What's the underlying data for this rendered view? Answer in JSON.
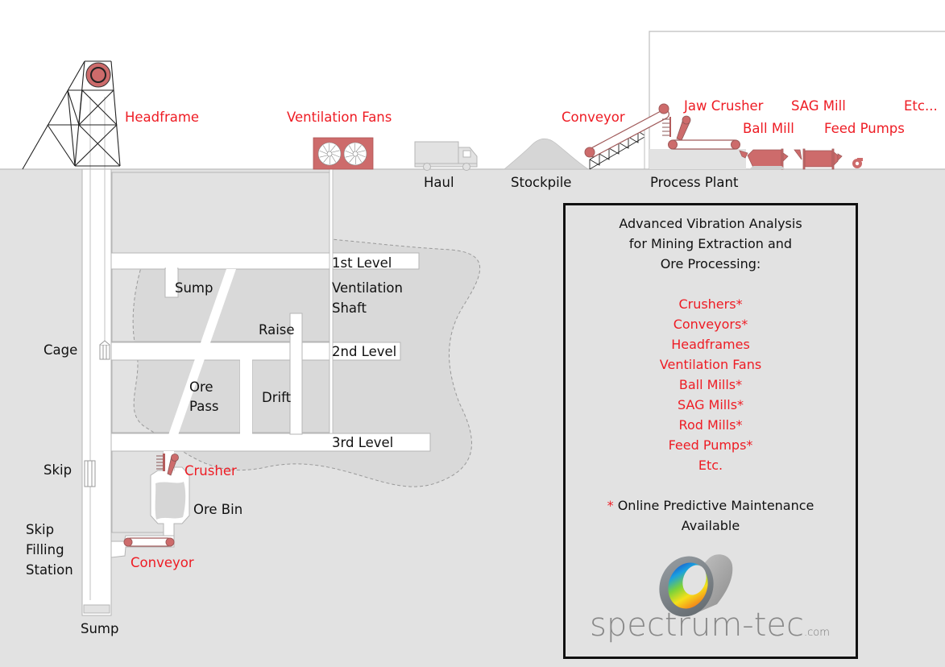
{
  "colors": {
    "label_red": "#ee1c24",
    "equipment_red": "#cd6b6b",
    "ground": "#e2e2e2",
    "orebody": "#d9d9d9",
    "tunnel": "#ffffff",
    "text": "#111111"
  },
  "surface_labels": {
    "headframe": "Headframe",
    "ventilation_fans": "Ventilation Fans",
    "haul": "Haul",
    "stockpile": "Stockpile",
    "conveyor": "Conveyor",
    "jaw_crusher": "Jaw Crusher",
    "sag_mill": "SAG Mill",
    "ball_mill": "Ball Mill",
    "feed_pumps": "Feed Pumps",
    "etc": "Etc...",
    "process_plant": "Process Plant"
  },
  "underground_labels": {
    "level_1": "1st Level",
    "level_2": "2nd Level",
    "level_3": "3rd Level",
    "sump_upper": "Sump",
    "ventilation_shaft_line1": "Ventilation",
    "ventilation_shaft_line2": "Shaft",
    "raise": "Raise",
    "cage": "Cage",
    "ore_pass_line1": "Ore",
    "ore_pass_line2": "Pass",
    "drift": "Drift",
    "skip": "Skip",
    "crusher": "Crusher",
    "ore_bin": "Ore Bin",
    "skip_filling_line1": "Skip",
    "skip_filling_line2": "Filling",
    "skip_filling_line3": "Station",
    "conveyor": "Conveyor",
    "sump_lower": "Sump"
  },
  "info_box": {
    "title_lines": [
      "Advanced Vibration Analysis",
      "for Mining Extraction and",
      "Ore Processing:"
    ],
    "services": [
      "Crushers*",
      "Conveyors*",
      "Headframes",
      "Ventilation Fans",
      "Ball Mills*",
      "SAG Mills*",
      "Rod Mills*",
      "Feed Pumps*",
      "Etc."
    ],
    "note_asterisk": "*",
    "note_line1": "Online Predictive Maintenance",
    "note_line2": "Available",
    "logo_text": "spectrum-tec",
    "logo_suffix": ".com"
  }
}
